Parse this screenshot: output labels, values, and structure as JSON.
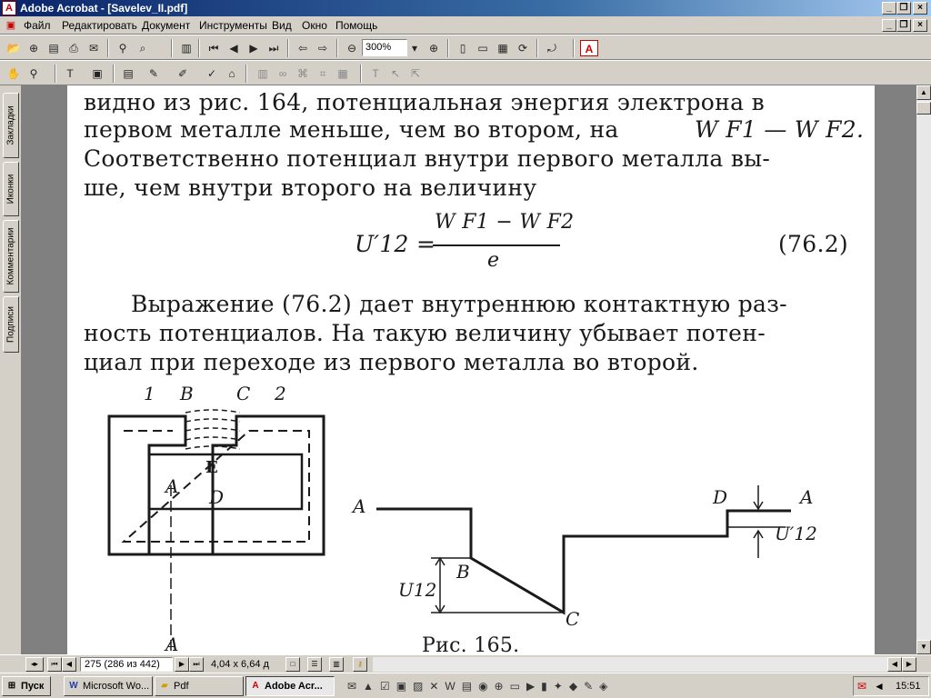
{
  "window": {
    "title": "Adobe Acrobat - [Savelev_II.pdf]"
  },
  "menu": [
    "Файл",
    "Редактировать",
    "Документ",
    "Инструменты",
    "Вид",
    "Окно",
    "Помощь"
  ],
  "toolbar": {
    "zoom": "300%"
  },
  "sidebar_tabs": [
    "Закладки",
    "Иконки",
    "Комментарии",
    "Подписи"
  ],
  "page_text": {
    "lines": [
      "видно из рис. 164, потенциальная энергия электрона в",
      "первом металле меньше, чем во втором, на",
      "Соответственно потенциал внутри первого металла вы-",
      "ше, чем внутри второго на величину"
    ],
    "line2_formula": "W F1 — W F2.",
    "equation": {
      "lhs": "U′12 =",
      "numerator": "W F1 − W F2",
      "denominator": "e",
      "number": "(76.2)"
    },
    "para2": [
      "Выражение (76.2) дает внутреннюю контактную раз-",
      "ность потенциалов. На такую величину убывает потен-",
      "циал при переходе из первого металла во второй."
    ],
    "figure_caption": "Рис. 165."
  },
  "figure_labels": {
    "left": {
      "n1": "1",
      "B": "B",
      "C": "C",
      "n2": "2",
      "E": "E",
      "A1": "A",
      "D": "D",
      "A2": "A"
    },
    "right": {
      "A_left": "A",
      "B": "B",
      "C": "C",
      "D": "D",
      "A_right": "A",
      "U12": "U12",
      "U12p": "U′12"
    }
  },
  "status": {
    "page": "275 (286 из 442)",
    "size": "4,04 x 6,64 д"
  },
  "taskbar": {
    "start": "Пуск",
    "tasks": [
      "Microsoft Wo...",
      "Pdf",
      "Adobe Acr..."
    ],
    "clock": "15:51"
  },
  "colors": {
    "titlebar": "#0a246a",
    "chrome": "#d4d0c8",
    "doc_bg": "#808080"
  }
}
